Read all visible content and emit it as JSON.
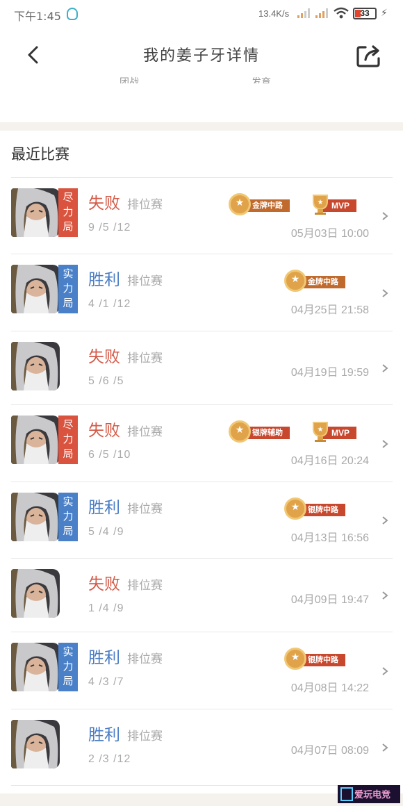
{
  "status_bar": {
    "time": "下午1:45",
    "net_speed": "13.4K/s",
    "battery": "33"
  },
  "nav": {
    "title": "我的姜子牙详情",
    "tab_left": "团战",
    "tab_right": "发育"
  },
  "section": {
    "title": "最近比赛"
  },
  "matches": [
    {
      "result": "失败",
      "outcome": "lose",
      "badge": [
        "尽",
        "力",
        "局"
      ],
      "badge_color": "red",
      "mode": "排位赛",
      "kda": "9 /5 /12",
      "datetime": "05月03日 10:00",
      "medals": [
        {
          "label": "金牌中路",
          "tier": "gold"
        }
      ],
      "mvp": "MVP"
    },
    {
      "result": "胜利",
      "outcome": "win",
      "badge": [
        "实",
        "力",
        "局"
      ],
      "badge_color": "blue",
      "mode": "排位赛",
      "kda": "4 /1 /12",
      "datetime": "04月25日 21:58",
      "medals": [
        {
          "label": "金牌中路",
          "tier": "gold"
        }
      ],
      "mvp": ""
    },
    {
      "result": "失败",
      "outcome": "lose",
      "badge": [],
      "badge_color": "",
      "mode": "排位赛",
      "kda": "5 /6 /5",
      "datetime": "04月19日 19:59",
      "medals": [],
      "mvp": ""
    },
    {
      "result": "失败",
      "outcome": "lose",
      "badge": [
        "尽",
        "力",
        "局"
      ],
      "badge_color": "red",
      "mode": "排位赛",
      "kda": "6 /5 /10",
      "datetime": "04月16日 20:24",
      "medals": [
        {
          "label": "银牌辅助",
          "tier": "silver"
        }
      ],
      "mvp": "MVP"
    },
    {
      "result": "胜利",
      "outcome": "win",
      "badge": [
        "实",
        "力",
        "局"
      ],
      "badge_color": "blue",
      "mode": "排位赛",
      "kda": "5 /4 /9",
      "datetime": "04月13日 16:56",
      "medals": [
        {
          "label": "银牌中路",
          "tier": "silver"
        }
      ],
      "mvp": ""
    },
    {
      "result": "失败",
      "outcome": "lose",
      "badge": [],
      "badge_color": "",
      "mode": "排位赛",
      "kda": "1 /4 /9",
      "datetime": "04月09日 19:47",
      "medals": [],
      "mvp": ""
    },
    {
      "result": "胜利",
      "outcome": "win",
      "badge": [
        "实",
        "力",
        "局"
      ],
      "badge_color": "blue",
      "mode": "排位赛",
      "kda": "4 /3 /7",
      "datetime": "04月08日 14:22",
      "medals": [
        {
          "label": "银牌中路",
          "tier": "silver"
        }
      ],
      "mvp": ""
    },
    {
      "result": "胜利",
      "outcome": "win",
      "badge": [],
      "badge_color": "",
      "mode": "排位赛",
      "kda": "2 /3 /12",
      "datetime": "04月07日 08:09",
      "medals": [],
      "mvp": ""
    }
  ],
  "watermark": "爱玩电竞",
  "colors": {
    "win": "#4a7cc4",
    "lose": "#d45a48",
    "badge_red": "#d9533f",
    "badge_blue": "#4a80c8",
    "band": "#f5f2ee"
  },
  "icons": [
    "back-arrow-icon",
    "share-icon",
    "chevron-right-icon",
    "medal-icon",
    "mvp-trophy-icon",
    "wifi-icon",
    "battery-icon"
  ]
}
